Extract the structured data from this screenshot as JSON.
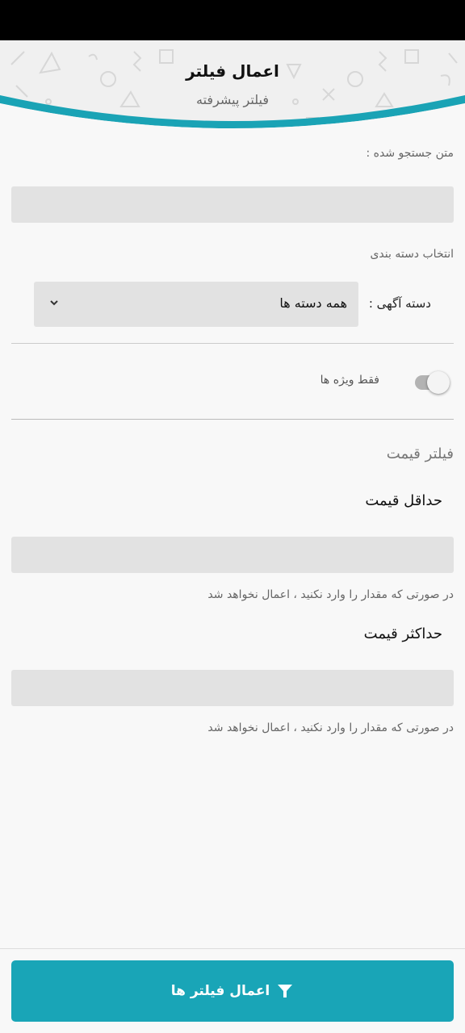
{
  "header": {
    "title": "اعمال فیلتر",
    "subtitle": "فیلتر پیشرفته"
  },
  "search": {
    "label": "متن جستجو شده :",
    "value": ""
  },
  "category": {
    "section_label": "انتخاب دسته بندی",
    "field_label": "دسته آگهی :",
    "selected": "همه دسته ها",
    "dropdown_icon": "chevron-down-icon"
  },
  "featured_toggle": {
    "label": "فقط ویژه ها",
    "enabled": false
  },
  "price_filter": {
    "title": "فیلتر قیمت",
    "min_title": "حداقل قیمت",
    "min_value": "",
    "min_hint": "در صورتی که مقدار را وارد نکنید ، اعمال نخواهد شد",
    "max_title": "حداکثر قیمت",
    "max_value": "",
    "max_hint": "در صورتی که مقدار را وارد نکنید ، اعمال نخواهد شد"
  },
  "apply_button": {
    "label": "اعمال فیلتر ها",
    "icon": "filter-icon",
    "color": "#19a5b7"
  },
  "colors": {
    "accent": "#19a5b7",
    "input_background": "#e2e2e2"
  }
}
